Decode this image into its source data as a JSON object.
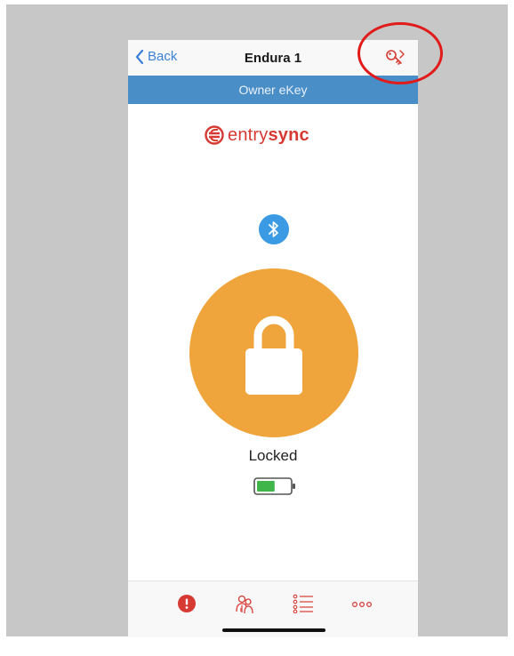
{
  "nav": {
    "back_label": "Back",
    "title": "Endura 1"
  },
  "subheader": {
    "label": "Owner eKey"
  },
  "logo": {
    "part1": "entry",
    "part2": "sync"
  },
  "lock": {
    "status": "Locked"
  },
  "battery": {
    "level": 0.55
  },
  "icons": {
    "key_share": "key-share-icon",
    "bluetooth": "bluetooth-icon",
    "padlock": "padlock-icon",
    "battery": "battery-icon"
  },
  "tabs": [
    {
      "icon": "alert-icon"
    },
    {
      "icon": "users-key-icon"
    },
    {
      "icon": "list-icon"
    },
    {
      "icon": "more-icon"
    }
  ],
  "colors": {
    "accent_blue": "#4a8ec7",
    "brand_red": "#d63a32",
    "lock_orange": "#f0a43c",
    "bluetooth_blue": "#3a9ae3",
    "battery_green": "#3fb54a",
    "annotation_red": "#e11a1a",
    "frame_gray": "#c7c7c7"
  }
}
